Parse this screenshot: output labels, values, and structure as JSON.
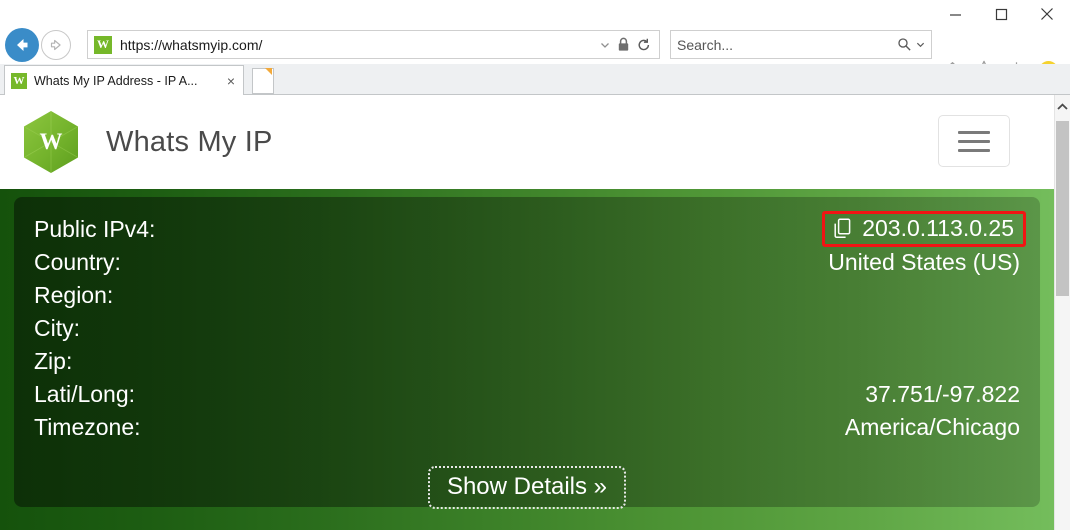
{
  "browser": {
    "window_controls": [
      {
        "name": "minimize",
        "glyph": "minimize-icon"
      },
      {
        "name": "maximize",
        "glyph": "maximize-icon"
      },
      {
        "name": "close",
        "glyph": "close-icon"
      }
    ],
    "back_label": "Back",
    "forward_label": "Forward",
    "address": {
      "url": "https://whatsmyip.com/",
      "favicon_letter": "W",
      "dropdown_icon": "chevron-down-icon",
      "lock_icon": "lock-icon",
      "refresh_icon": "refresh-icon"
    },
    "search": {
      "placeholder": "Search...",
      "value": "Search...",
      "search_icon": "magnifier-icon",
      "dropdown_icon": "chevron-down-icon"
    },
    "toolbar_icons": [
      {
        "name": "home-icon",
        "label": "Home"
      },
      {
        "name": "favorites-icon",
        "label": "Favorites"
      },
      {
        "name": "tools-icon",
        "label": "Tools"
      },
      {
        "name": "smiley-icon",
        "label": "Send a smile"
      }
    ],
    "tab": {
      "title": "Whats My IP Address - IP A...",
      "favicon_letter": "W",
      "close_glyph": "×"
    },
    "new_tab_label": "New tab"
  },
  "site": {
    "logo_letter": "W",
    "title": "Whats My IP",
    "menu_label": "Menu"
  },
  "hero": {
    "rows": [
      {
        "label": "Public IPv4:",
        "value": "203.0.113.0.25",
        "highlighted": true,
        "has_copy_icon": true
      },
      {
        "label": "Country:",
        "value": "United States (US)",
        "highlighted": false,
        "has_copy_icon": false
      },
      {
        "label": "Region:",
        "value": "",
        "highlighted": false,
        "has_copy_icon": false
      },
      {
        "label": "City:",
        "value": "",
        "highlighted": false,
        "has_copy_icon": false
      },
      {
        "label": "Zip:",
        "value": "",
        "highlighted": false,
        "has_copy_icon": false
      },
      {
        "label": "Lati/Long:",
        "value": "37.751/-97.822",
        "highlighted": false,
        "has_copy_icon": false
      },
      {
        "label": "Timezone:",
        "value": "America/Chicago",
        "highlighted": false,
        "has_copy_icon": false
      }
    ],
    "show_details_label": "Show Details »",
    "copy_icon_name": "copy-icon",
    "highlight_color": "#f11414"
  },
  "scrollbar": {
    "up_arrow": "chevron-up-icon"
  }
}
